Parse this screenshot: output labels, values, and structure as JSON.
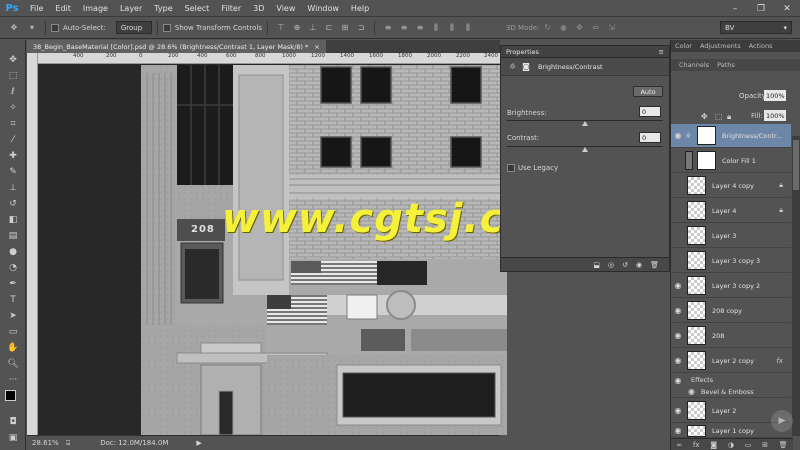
{
  "app": {
    "logo": "Ps"
  },
  "menu": [
    "File",
    "Edit",
    "Image",
    "Layer",
    "Type",
    "Select",
    "Filter",
    "3D",
    "View",
    "Window",
    "Help"
  ],
  "window_controls": [
    "–",
    "❐",
    "✕"
  ],
  "options_bar": {
    "auto_select_label": "Auto-Select:",
    "auto_select_value": "Group",
    "show_transform_label": "Show Transform Controls",
    "mode_3d_label": "3D Mode:",
    "workspace_value": "BV"
  },
  "document": {
    "tab_title": "38_Begin_BaseMaterial [Color].psd @ 28.6% (Brightness/Contrast 1, Layer Mask/8) *",
    "tab_close": "×",
    "ruler_ticks": [
      "400",
      "200",
      "0",
      "200",
      "400",
      "600",
      "800",
      "1000",
      "1200",
      "1400",
      "1600",
      "1800",
      "2000",
      "2200",
      "2400"
    ],
    "zoom": "28.61%",
    "doc_size": "Doc: 12.0M/184.0M",
    "sign_number": "208"
  },
  "properties": {
    "panel_title": "Properties",
    "adjustment_title": "Brightness/Contrast",
    "auto_label": "Auto",
    "brightness_label": "Brightness:",
    "brightness_value": "0",
    "contrast_label": "Contrast:",
    "contrast_value": "0",
    "use_legacy_label": "Use Legacy",
    "brightness_fraction": 0.5,
    "contrast_fraction": 0.5
  },
  "right_panel": {
    "top_tabs": [
      "Color",
      "Adjustments",
      "Actions"
    ],
    "sub_tabs": [
      "Channels",
      "Paths"
    ],
    "opacity_label": "Opacity:",
    "opacity_value": "100%",
    "fill_label": "Fill:",
    "fill_value": "100%",
    "effects_label": "Effects",
    "bevel_label": "Bevel & Emboss",
    "fx_label": "fx"
  },
  "layers": [
    {
      "name": "Brightness/Contr...",
      "visible": true,
      "locked": false,
      "type": "adjustment"
    },
    {
      "name": "Color Fill 1",
      "visible": false,
      "locked": false,
      "type": "fill"
    },
    {
      "name": "Layer 4 copy",
      "visible": false,
      "locked": true,
      "type": "pixel"
    },
    {
      "name": "Layer 4",
      "visible": false,
      "locked": true,
      "type": "pixel"
    },
    {
      "name": "Layer 3",
      "visible": false,
      "locked": false,
      "type": "pixel"
    },
    {
      "name": "Layer 3 copy 3",
      "visible": false,
      "locked": false,
      "type": "pixel"
    },
    {
      "name": "Layer 3 copy 2",
      "visible": true,
      "locked": false,
      "type": "pixel"
    },
    {
      "name": "208 copy",
      "visible": true,
      "locked": false,
      "type": "pixel"
    },
    {
      "name": "208",
      "visible": true,
      "locked": false,
      "type": "pixel"
    },
    {
      "name": "Layer 2 copy",
      "visible": true,
      "locked": false,
      "type": "pixel",
      "fx": true
    },
    {
      "name": "Layer 2",
      "visible": true,
      "locked": false,
      "type": "pixel"
    },
    {
      "name": "Layer 1 copy",
      "visible": true,
      "locked": false,
      "type": "pixel"
    }
  ],
  "watermark": "www.cgtsj.com",
  "colors": {
    "accent": "#31a8ff",
    "watermark": "#f5f03a",
    "panel": "#535353",
    "selected_layer": "#6d87a8"
  }
}
